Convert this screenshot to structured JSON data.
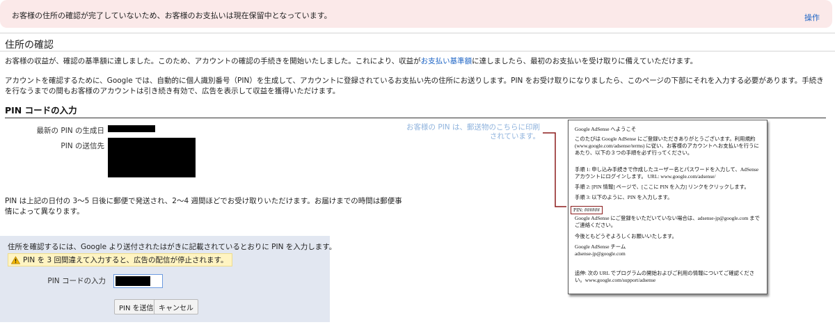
{
  "alert": {
    "message": "お客様の住所の確認が完了していないため、お客様のお支払いは現在保留中となっています。",
    "action": "操作"
  },
  "page": {
    "title": "住所の確認",
    "para1_before": "お客様の収益が、確認の基準額に達しました。このため、アカウントの確認の手続きを開始いたしました。これにより、収益が",
    "para1_link": "お支払い基準額",
    "para1_after": "に達しましたら、最初のお支払いを受け取りに備えていただけます。",
    "para2": "アカウントを確認するために、Google では、自動的に個人識別番号（PIN）を生成して、アカウントに登録されているお支払い先の住所にお送りします。PIN をお受け取りになりましたら、このページの下部にそれを入力する必要があります。手続きを行なうまでの間もお客様のアカウントは引き続き有効で、広告を表示して収益を獲得いただけます。"
  },
  "pin_section": {
    "title": "PIN コードの入力",
    "latest_pin_label": "最新の PIN の生成日",
    "pin_sent_to_label": "PIN の送信先",
    "delivery_note": "PIN は上記の日付の 3～5 日後に郵便で発送され、2～4 週間ほどでお受け取りいただけます。お届けまでの時間は郵便事情によって異なります。"
  },
  "form": {
    "instruction": "住所を確認するには、Google より送付されたはがきに記載されているとおりに PIN を入力します。",
    "warning": "PIN を 3 回間違えて入力すると、広告の配信が停止されます。",
    "pin_label": "PIN コードの入力",
    "submit_label": "PIN を送信",
    "cancel_label": "キャンセル"
  },
  "callout": {
    "text": "お客様の PIN は、郵送物のこちらに印刷されています。"
  },
  "letter": {
    "greeting": "Google AdSense へようこそ",
    "intro": "このたびは Google AdSense にご登録いただきありがとうございます。利用規約 (www.google.com/adsense/terms) に従い、お客様のアカウントへお支払いを行うにあたり、以下の３つの手順を必ず行ってください。",
    "step1": "手順 1: 申し込み手続きで作成したユーザー名とパスワードを入力して、AdSense アカウントにログインします。 URL: www.google.com/adsense/",
    "step2": "手順 2: [PIN 情報] ページで、[ここに PIN を入力] リンクをクリックします。",
    "step3": "手順 3: 以下のように、PIN を入力します。",
    "pin": "PIN: ######",
    "help": "Google AdSense にご登録をいただいていない場合は、adsense-jp@google.com までご連絡ください。",
    "regards": "今後ともどうぞよろしくお願いいたします。",
    "team": "Google AdSense チーム",
    "email": "adsense-jp@google.com",
    "ps": "追伸: 次の URL でプログラムの開始およびご利用の情報についてご確認ください。www.google.com/support/adsense"
  },
  "colors": {
    "alert_bg": "#fbe9e9",
    "link": "#1a62c4",
    "form_panel_bg": "#e2e7f1",
    "warning_bg": "#fff4c2",
    "callout_text": "#8fb3dd",
    "pin_highlight": "#8b1a1a"
  },
  "icons": {
    "warning": "warning-triangle-icon"
  }
}
